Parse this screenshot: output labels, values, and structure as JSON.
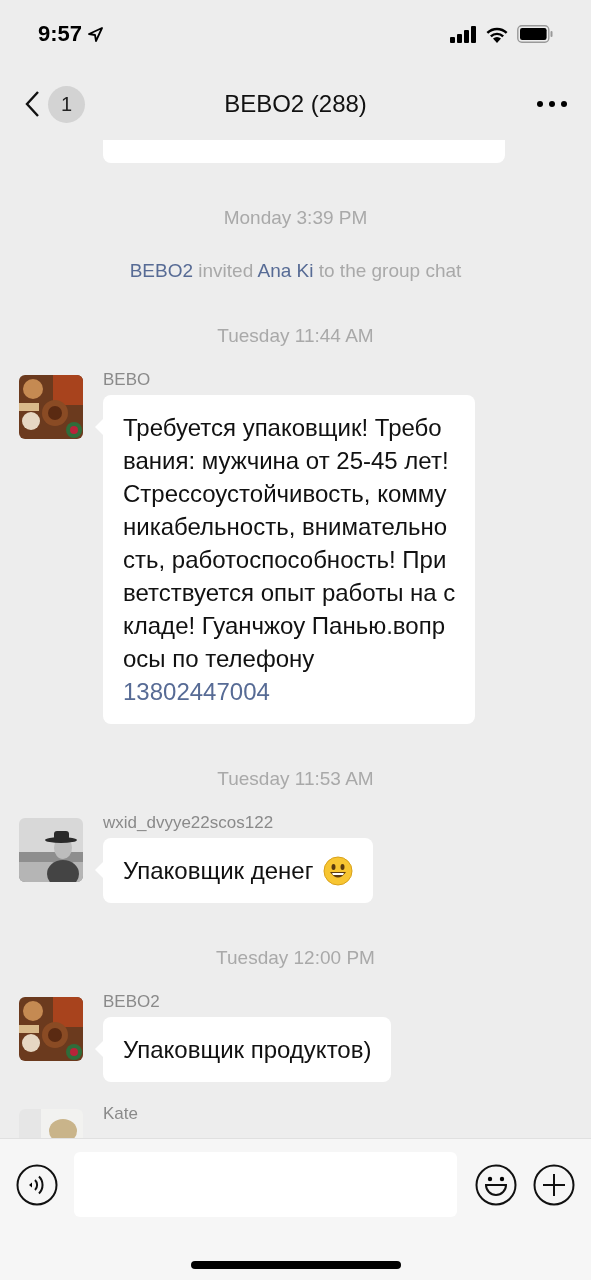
{
  "status_bar": {
    "time": "9:57"
  },
  "header": {
    "title": "BEBO2 (288)",
    "unread": "1"
  },
  "messages": [
    {
      "kind": "cut_bubble"
    },
    {
      "kind": "time",
      "text": "Monday 3:39 PM"
    },
    {
      "kind": "system",
      "parts": [
        {
          "kind": "name",
          "text": "BEBO2"
        },
        {
          "kind": "plain",
          "text": " invited "
        },
        {
          "kind": "name",
          "text": "Ana Ki"
        },
        {
          "kind": "plain",
          "text": " to the group chat"
        }
      ]
    },
    {
      "kind": "time",
      "text": "Tuesday 11:44 AM"
    },
    {
      "kind": "message",
      "sender": "BEBO",
      "text": "Требуется упаковщик! Требо\nвания: мужчина от 25-45 лет!\nСтрессоустойчивость, комму\nникабельность, внимательно\nсть, работоспособность! При\nветствуется опыт работы на с\nкладе! Гуанчжоу Панью.вопр\nосы по телефону",
      "link": "13802447004"
    },
    {
      "kind": "time",
      "text": "Tuesday 11:53 AM"
    },
    {
      "kind": "message",
      "sender": "wxid_dvyye22scos122",
      "text": "Упаковщик денег",
      "emoji": true
    },
    {
      "kind": "time",
      "text": "Tuesday 12:00 PM"
    },
    {
      "kind": "message",
      "sender": "BEBO2",
      "text": "Упаковщик продуктов)"
    },
    {
      "kind": "message",
      "sender": "Kate"
    }
  ]
}
